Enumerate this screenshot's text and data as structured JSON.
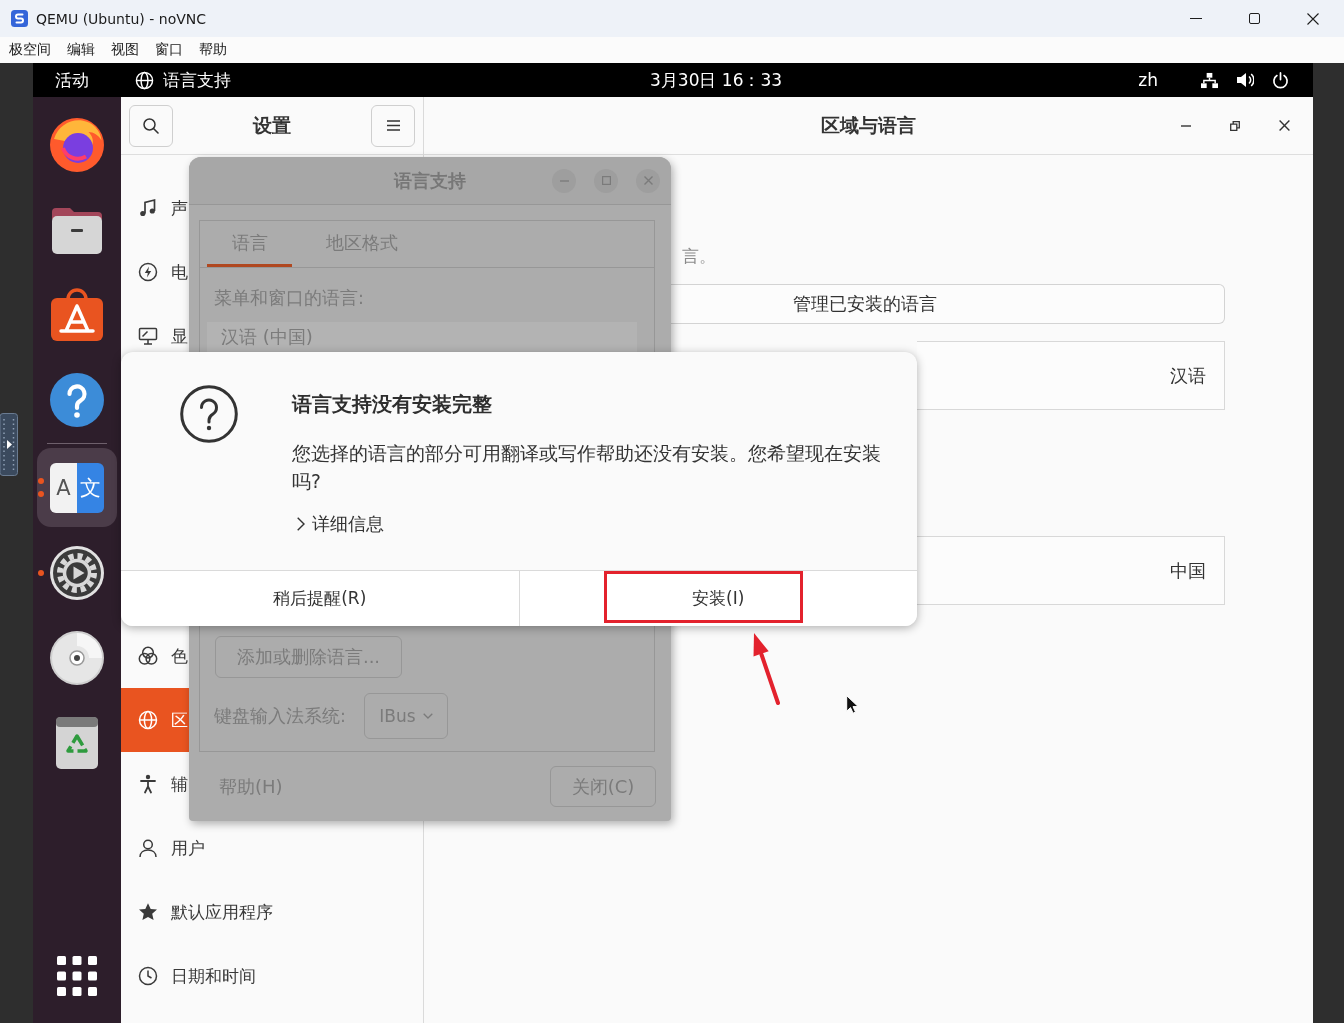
{
  "host_window": {
    "title": "QEMU (Ubuntu) - noVNC",
    "menu": [
      "极空间",
      "编辑",
      "视图",
      "窗口",
      "帮助"
    ]
  },
  "top_bar": {
    "activities": "活动",
    "app_name": "语言支持",
    "clock": "3月30日 16：33",
    "input_source": "zh"
  },
  "dock": {
    "items": [
      {
        "kind": "browser",
        "selected": false,
        "running": false,
        "multi_window": false
      },
      {
        "kind": "files",
        "selected": false,
        "running": false,
        "multi_window": false
      },
      {
        "kind": "software",
        "selected": false,
        "running": false,
        "multi_window": false
      },
      {
        "kind": "help",
        "selected": false,
        "running": false,
        "multi_window": false
      },
      {
        "kind": "separator"
      },
      {
        "kind": "language",
        "glyphs": [
          "A",
          "文"
        ],
        "selected": true,
        "running": true,
        "multi_window": true
      },
      {
        "kind": "settings",
        "selected": false,
        "running": true,
        "multi_window": false
      },
      {
        "kind": "disc",
        "selected": false,
        "running": false,
        "multi_window": false
      },
      {
        "kind": "trash",
        "selected": false,
        "running": false,
        "multi_window": false
      }
    ]
  },
  "settings_window": {
    "sidebar": {
      "title": "设置",
      "groups": [
        {
          "items": [
            {
              "kind": "sound",
              "label": "声",
              "selected": false
            },
            {
              "kind": "power",
              "label": "电",
              "selected": false
            },
            {
              "kind": "display",
              "label": "显",
              "selected": false
            }
          ]
        },
        {
          "items": [
            {
              "kind": "color",
              "label": "色",
              "selected": false
            },
            {
              "kind": "region",
              "label": "区",
              "selected": true
            },
            {
              "kind": "accessibility",
              "label": "辅",
              "selected": false
            }
          ]
        },
        {
          "items": [
            {
              "kind": "users",
              "label": "用户",
              "selected": false
            },
            {
              "kind": "default_apps",
              "label": "默认应用程序",
              "selected": false
            },
            {
              "kind": "date_time",
              "label": "日期和时间",
              "selected": false
            }
          ]
        }
      ]
    },
    "panel": {
      "title": "区域与语言",
      "note": "言。",
      "manage_button": "管理已安装的语言",
      "rows": [
        {
          "value": "汉语"
        },
        {
          "value": "中国"
        }
      ]
    }
  },
  "language_dialog": {
    "title": "语言支持",
    "dimmed": true,
    "tabs": [
      {
        "label": "语言",
        "selected": true
      },
      {
        "label": "地区格式",
        "selected": false
      }
    ],
    "list_label": "菜单和窗口的语言:",
    "languages": [
      "汉语 (中国)"
    ],
    "add_remove_button": "添加或删除语言...",
    "input_label": "键盘输入法系统:",
    "input_method": "IBus",
    "help_button": "帮助(H)",
    "close_button": "关闭(C)"
  },
  "alert": {
    "title": "语言支持没有安装完整",
    "message": "您选择的语言的部分可用翻译或写作帮助还没有安装。您希望现在安装吗?",
    "details": {
      "label": "详细信息",
      "expanded": false
    },
    "buttons": [
      {
        "label": "稍后提醒(R)",
        "annotated": false
      },
      {
        "label": "安装(I)",
        "annotated": true
      }
    ]
  }
}
